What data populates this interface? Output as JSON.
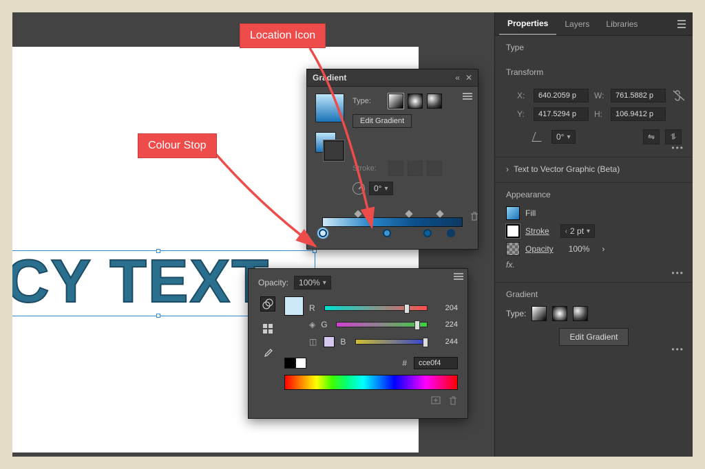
{
  "annotations": {
    "location_icon": "Location Icon",
    "colour_stop": "Colour Stop"
  },
  "canvas": {
    "text": "CY TEXT"
  },
  "gradient_panel": {
    "title": "Gradient",
    "type_label": "Type:",
    "edit_button": "Edit Gradient",
    "stroke_label": "Stroke:",
    "angle_value": "0°",
    "stops": [
      {
        "pos": 0,
        "color": "#cde8f6",
        "selected": true
      },
      {
        "pos": 46,
        "color": "#3a95d0",
        "selected": false
      },
      {
        "pos": 75,
        "color": "#0b5f9a",
        "selected": false
      },
      {
        "pos": 92,
        "color": "#0b3a63",
        "selected": false
      }
    ],
    "location_carets": [
      25,
      62,
      84
    ]
  },
  "color_picker": {
    "opacity_label": "Opacity:",
    "opacity_value": "100%",
    "channels": {
      "R": 204,
      "G": 224,
      "B": 244
    },
    "hex_label": "#",
    "hex_value": "cce0f4"
  },
  "properties": {
    "tabs": [
      "Properties",
      "Layers",
      "Libraries"
    ],
    "active_tab": 0,
    "type_section": "Type",
    "transform": {
      "title": "Transform",
      "x": "640.2059 p",
      "y": "417.5294 p",
      "w": "761.5882 p",
      "h": "106.9412 p",
      "angle": "0°"
    },
    "text_to_vector": "Text to Vector Graphic (Beta)",
    "appearance": {
      "title": "Appearance",
      "fill_label": "Fill",
      "stroke_label": "Stroke",
      "stroke_weight": "2 pt",
      "opacity_label": "Opacity",
      "opacity_value": "100%",
      "fx_label": "fx."
    },
    "gradient": {
      "title": "Gradient",
      "type_label": "Type:",
      "edit_button": "Edit Gradient"
    }
  }
}
